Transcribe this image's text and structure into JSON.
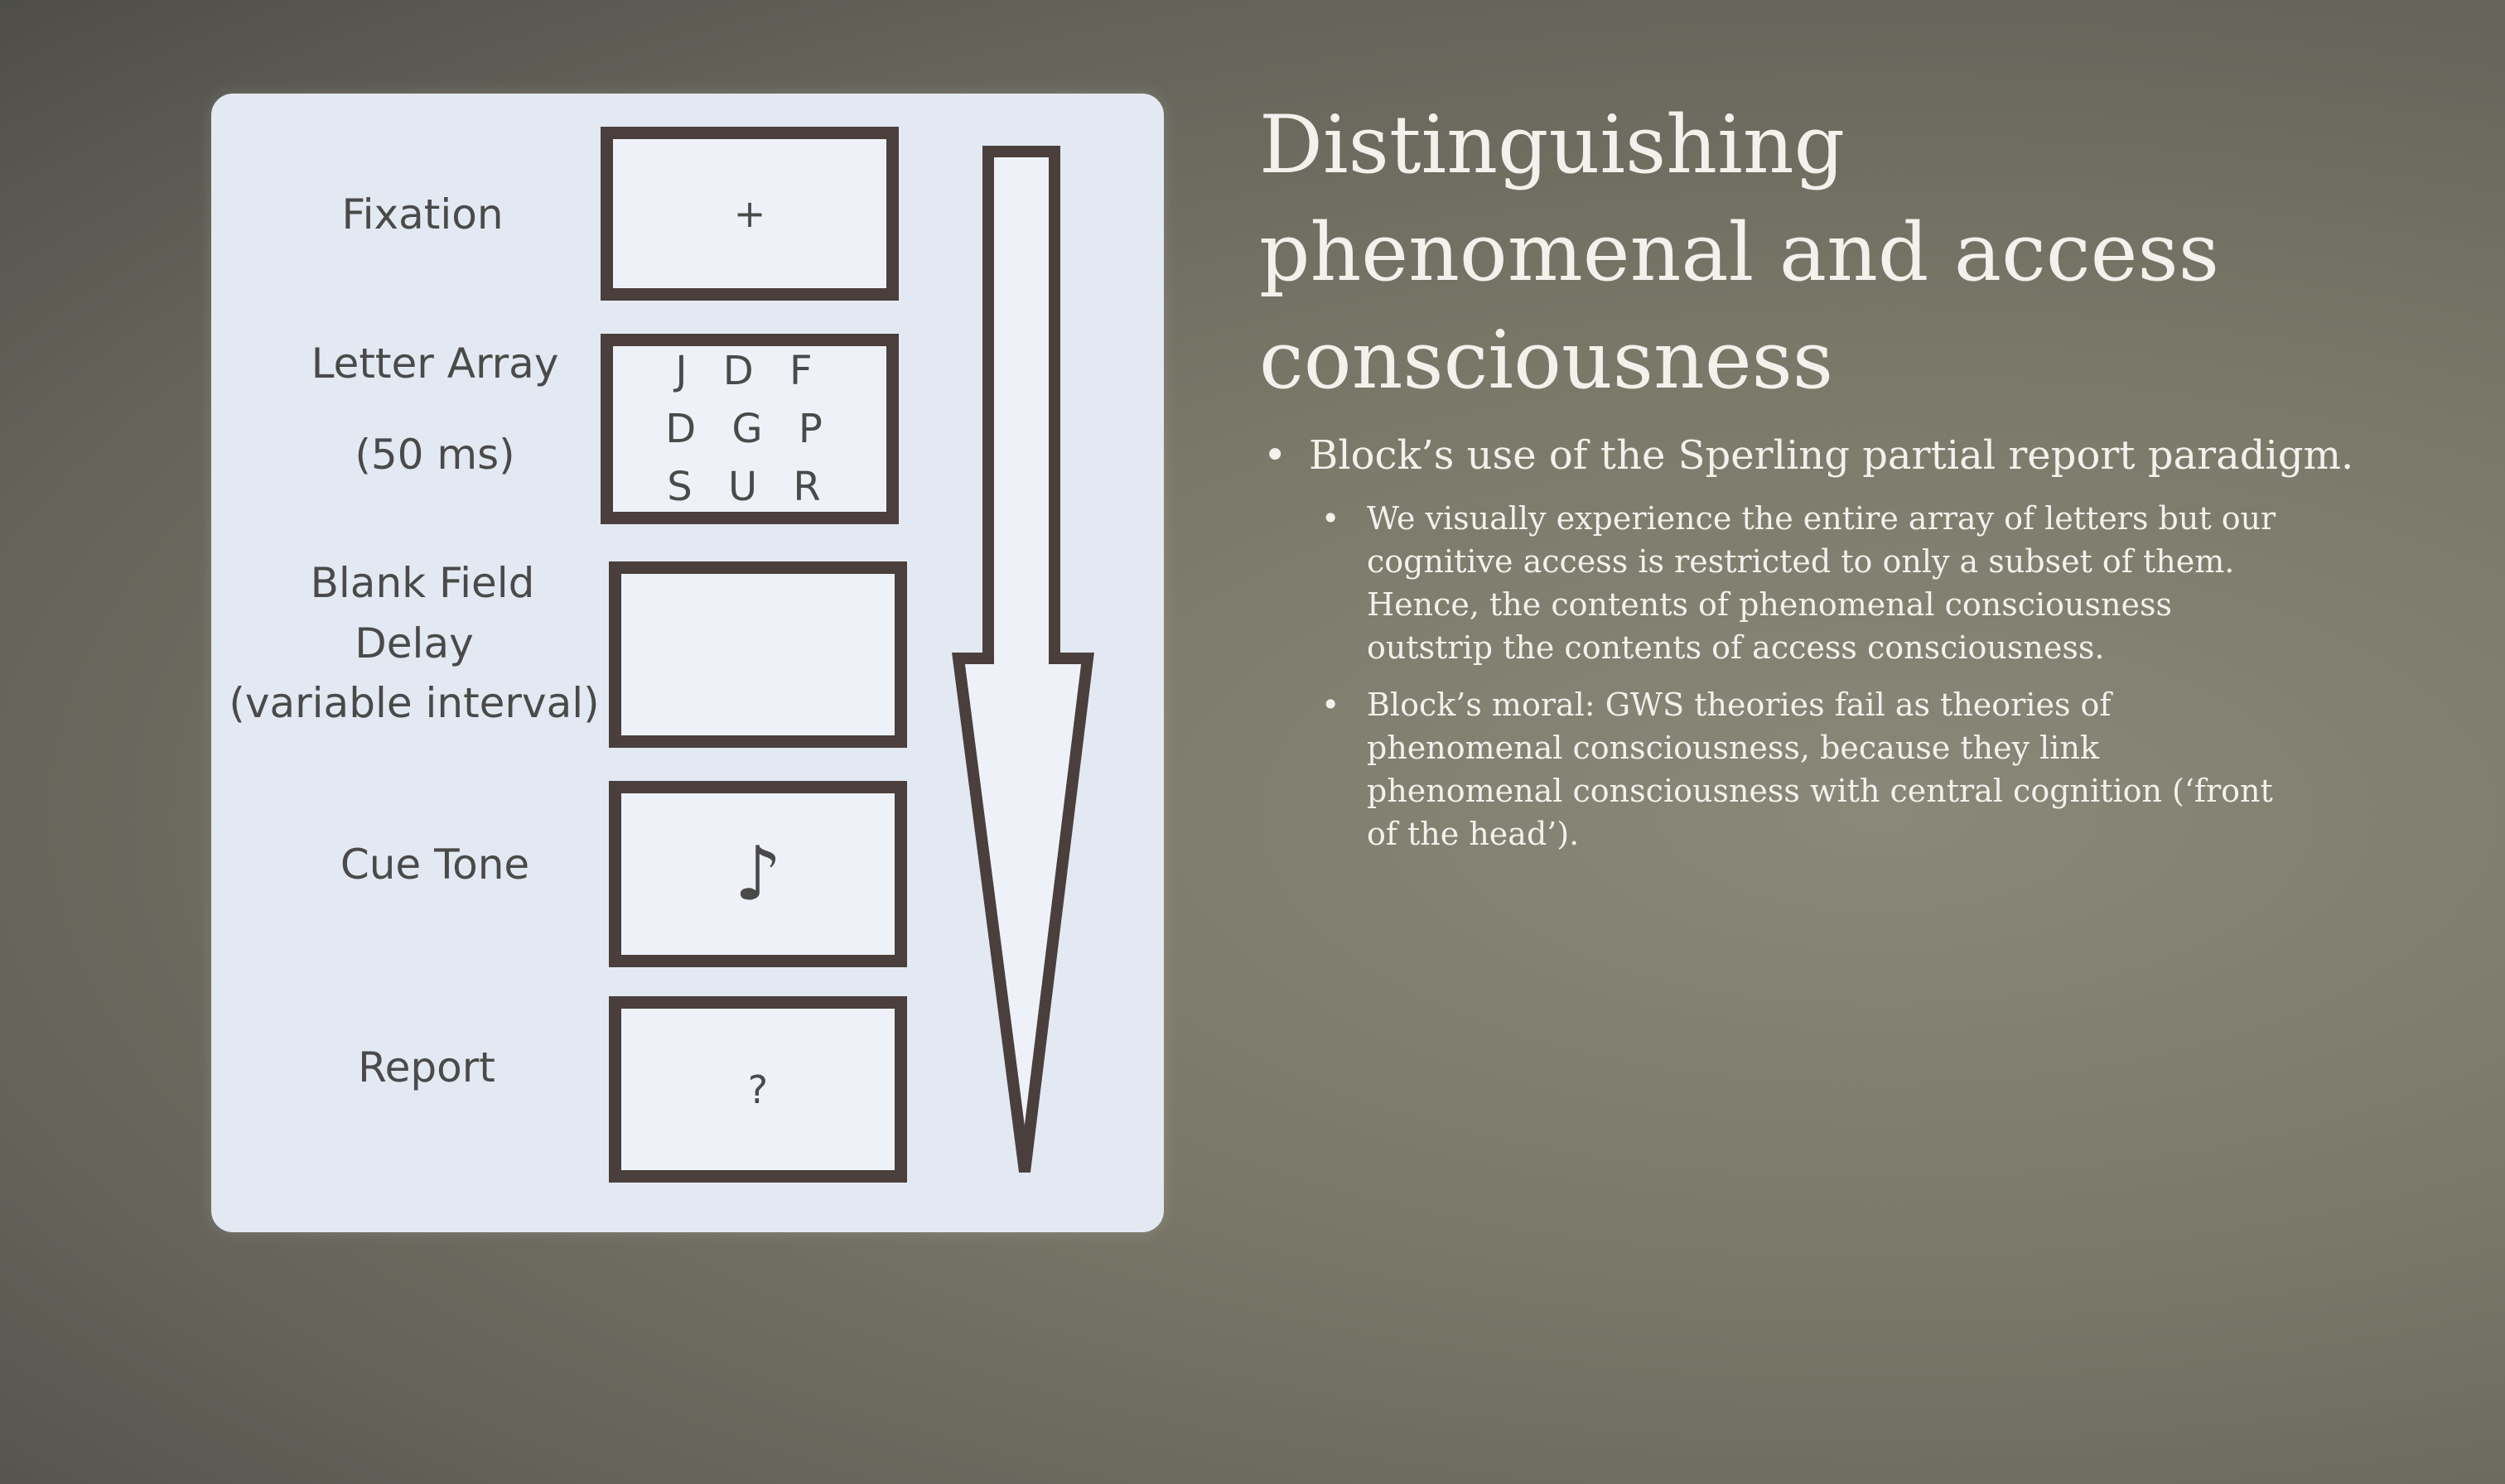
{
  "diagram": {
    "stages": [
      {
        "label": "Fixation",
        "content": "+"
      },
      {
        "label": "Letter Array",
        "sublabel": "(50 ms)",
        "letters": [
          "J D F",
          "D G P",
          "S U R"
        ]
      },
      {
        "label": "Blank Field",
        "sublabel": "Delay",
        "sublabel2": "(variable interval)",
        "content": ""
      },
      {
        "label": "Cue Tone",
        "content": "♪"
      },
      {
        "label": "Report",
        "content": "?"
      }
    ]
  },
  "slide": {
    "title_lines": [
      "Distinguishing",
      "phenomenal and access",
      "consciousness"
    ],
    "bullet": "Block’s use of the Sperling partial report paradigm.",
    "sub_bullets": [
      "We visually experience the entire array of letters but our cognitive access is restricted to only a subset of them. Hence, the contents of phenomenal consciousness outstrip the contents of access consciousness.",
      "Block’s moral: GWS theories fail as theories of phenomenal consciousness, because they link phenomenal consciousness with central cognition (‘front of the head’)."
    ]
  }
}
